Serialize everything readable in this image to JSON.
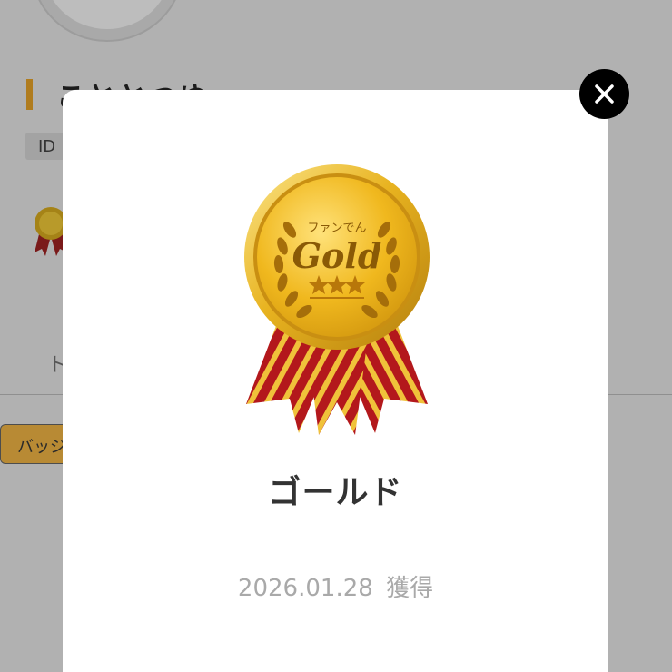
{
  "background_page": {
    "profile_name": "こととつゆ",
    "id_label": "ID",
    "tab_label_partial": "ト",
    "badge_button_label_partial": "バッジ"
  },
  "modal": {
    "medal": {
      "emblem_text_small": "ファンでん",
      "emblem_text_main": "Gold"
    },
    "badge_title": "ゴールド",
    "earned_date": "2026.01.28",
    "earned_suffix": "獲得"
  },
  "colors": {
    "overlay_dim": "#b1b1b1",
    "modal_bg": "#ffffff",
    "title_text": "#333333",
    "date_text": "#a9a9a9",
    "close_bg": "#000000",
    "gold": "#e8b320",
    "ribbon_red": "#b3181c"
  },
  "icons": {
    "close": "close-icon",
    "medal": "gold-medal-icon"
  }
}
